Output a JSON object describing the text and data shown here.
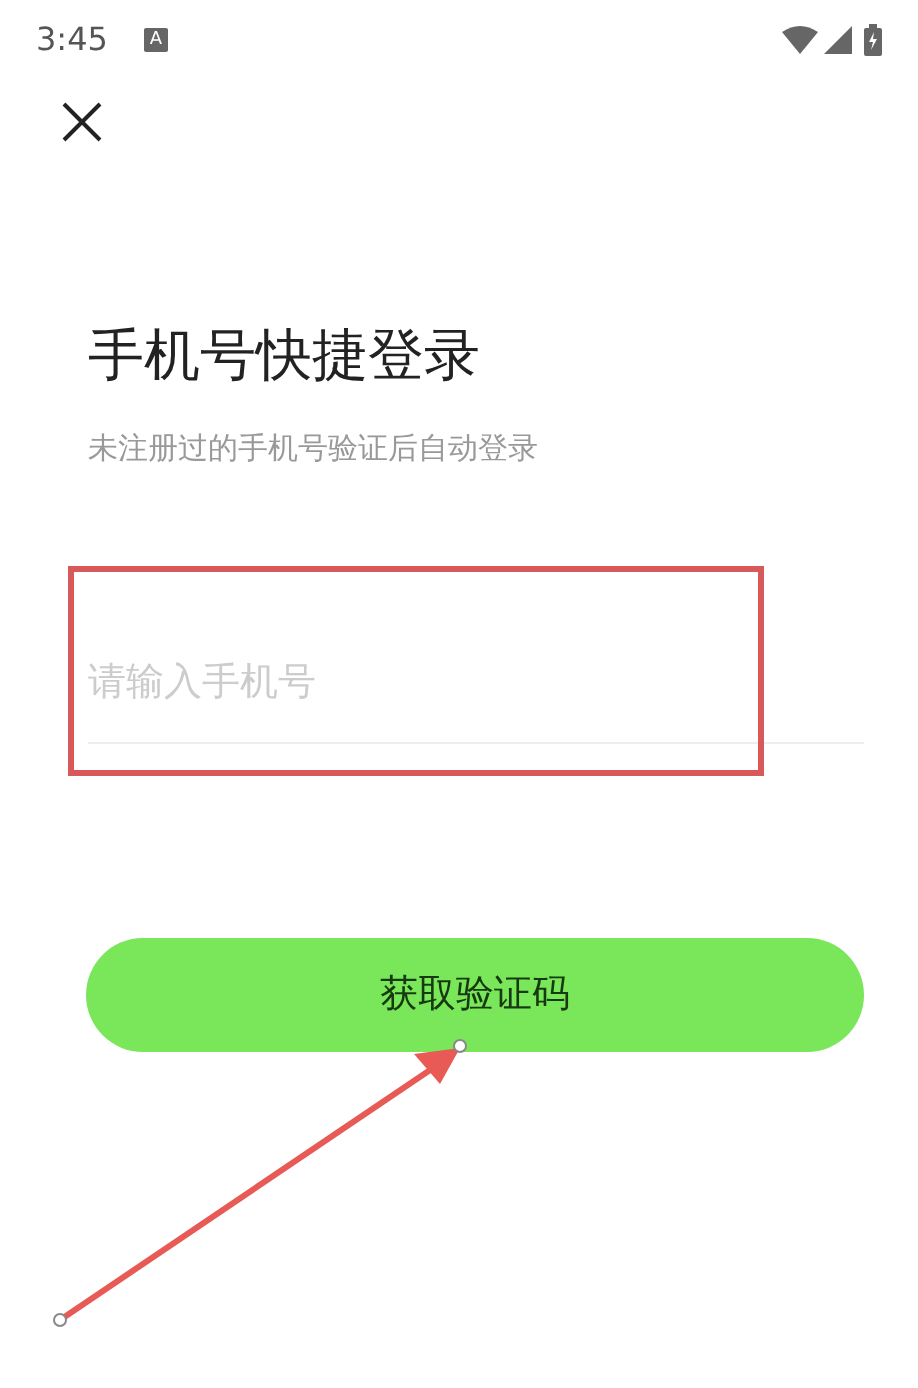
{
  "status_bar": {
    "time": "3:45",
    "notification_badge": "A"
  },
  "title": "手机号快捷登录",
  "subtitle": "未注册过的手机号验证后自动登录",
  "phone_field": {
    "placeholder": "请输入手机号"
  },
  "submit_button": {
    "label": "获取验证码"
  }
}
